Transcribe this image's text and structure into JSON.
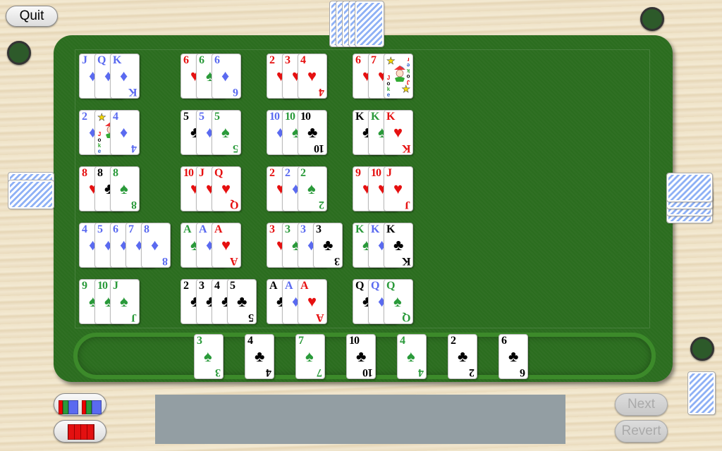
{
  "suit_colors": {
    "hearts": "#e61010",
    "diamonds": "#5a6af0",
    "spades": "#2a9a3a",
    "clubs": "#000000"
  },
  "suit_glyphs": {
    "hearts": "♥",
    "diamonds": "♦",
    "spades": "♠",
    "clubs": "♣"
  },
  "buttons": {
    "quit": "Quit",
    "next": "Next",
    "revert": "Revert"
  },
  "joker_label": "Joker",
  "message": "",
  "melds": [
    [
      [
        {
          "r": "J",
          "s": "diamonds"
        },
        {
          "r": "Q",
          "s": "diamonds"
        },
        {
          "r": "K",
          "s": "diamonds"
        }
      ],
      [
        {
          "r": "6",
          "s": "hearts"
        },
        {
          "r": "6",
          "s": "spades"
        },
        {
          "r": "6",
          "s": "diamonds"
        }
      ],
      [
        {
          "r": "2",
          "s": "hearts"
        },
        {
          "r": "3",
          "s": "hearts"
        },
        {
          "r": "4",
          "s": "hearts"
        }
      ],
      [
        {
          "r": "6",
          "s": "hearts"
        },
        {
          "r": "7",
          "s": "hearts"
        },
        {
          "r": "Joker",
          "s": "joker"
        }
      ]
    ],
    [
      [
        {
          "r": "2",
          "s": "diamonds"
        },
        {
          "r": "Joker",
          "s": "joker"
        },
        {
          "r": "4",
          "s": "diamonds"
        }
      ],
      [
        {
          "r": "5",
          "s": "clubs"
        },
        {
          "r": "5",
          "s": "diamonds"
        },
        {
          "r": "5",
          "s": "spades"
        }
      ],
      [
        {
          "r": "10",
          "s": "diamonds"
        },
        {
          "r": "10",
          "s": "spades"
        },
        {
          "r": "10",
          "s": "clubs"
        }
      ],
      [
        {
          "r": "K",
          "s": "clubs"
        },
        {
          "r": "K",
          "s": "spades"
        },
        {
          "r": "K",
          "s": "hearts"
        }
      ]
    ],
    [
      [
        {
          "r": "8",
          "s": "hearts"
        },
        {
          "r": "8",
          "s": "clubs"
        },
        {
          "r": "8",
          "s": "spades"
        }
      ],
      [
        {
          "r": "10",
          "s": "hearts"
        },
        {
          "r": "J",
          "s": "hearts"
        },
        {
          "r": "Q",
          "s": "hearts"
        }
      ],
      [
        {
          "r": "2",
          "s": "hearts"
        },
        {
          "r": "2",
          "s": "diamonds"
        },
        {
          "r": "2",
          "s": "spades"
        }
      ],
      [
        {
          "r": "9",
          "s": "hearts"
        },
        {
          "r": "10",
          "s": "hearts"
        },
        {
          "r": "J",
          "s": "hearts"
        }
      ]
    ],
    [
      [
        {
          "r": "4",
          "s": "diamonds"
        },
        {
          "r": "5",
          "s": "diamonds"
        },
        {
          "r": "6",
          "s": "diamonds"
        },
        {
          "r": "7",
          "s": "diamonds"
        },
        {
          "r": "8",
          "s": "diamonds"
        }
      ],
      [
        {
          "r": "A",
          "s": "spades"
        },
        {
          "r": "A",
          "s": "diamonds"
        },
        {
          "r": "A",
          "s": "hearts"
        }
      ],
      [
        {
          "r": "3",
          "s": "hearts"
        },
        {
          "r": "3",
          "s": "spades"
        },
        {
          "r": "3",
          "s": "diamonds"
        },
        {
          "r": "3",
          "s": "clubs"
        }
      ],
      [
        {
          "r": "K",
          "s": "spades"
        },
        {
          "r": "K",
          "s": "diamonds"
        },
        {
          "r": "K",
          "s": "clubs"
        }
      ]
    ],
    [
      [
        {
          "r": "9",
          "s": "spades"
        },
        {
          "r": "10",
          "s": "spades"
        },
        {
          "r": "J",
          "s": "spades"
        }
      ],
      [
        {
          "r": "2",
          "s": "clubs"
        },
        {
          "r": "3",
          "s": "clubs"
        },
        {
          "r": "4",
          "s": "clubs"
        },
        {
          "r": "5",
          "s": "clubs"
        }
      ],
      [
        {
          "r": "A",
          "s": "clubs"
        },
        {
          "r": "A",
          "s": "diamonds"
        },
        {
          "r": "A",
          "s": "hearts"
        }
      ],
      [
        {
          "r": "Q",
          "s": "clubs"
        },
        {
          "r": "Q",
          "s": "diamonds"
        },
        {
          "r": "Q",
          "s": "spades"
        }
      ]
    ]
  ],
  "hand": [
    {
      "r": "3",
      "s": "spades"
    },
    {
      "r": "4",
      "s": "clubs"
    },
    {
      "r": "7",
      "s": "spades"
    },
    {
      "r": "10",
      "s": "clubs"
    },
    {
      "r": "4",
      "s": "spades"
    },
    {
      "r": "2",
      "s": "clubs"
    },
    {
      "r": "6",
      "s": "clubs"
    }
  ],
  "opponents": {
    "top_cards": 5,
    "left_cards": 2,
    "right_cards": 4
  }
}
